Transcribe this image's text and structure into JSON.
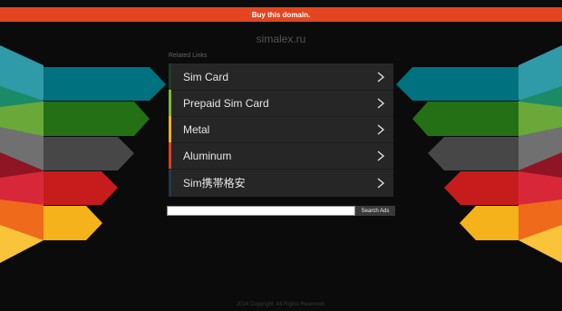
{
  "banner": {
    "label": "Buy this domain.",
    "color": "#e2451f"
  },
  "domain": "simalex.ru",
  "related": {
    "heading": "Related Links",
    "items": [
      {
        "label": "Sim Card",
        "color": "#1f3a2e"
      },
      {
        "label": "Prepaid Sim Card",
        "color": "#7eb936"
      },
      {
        "label": "Metal",
        "color": "#f0b21a"
      },
      {
        "label": "Aluminum",
        "color": "#d9401f"
      },
      {
        "label": "Sim携帯格安",
        "color": "#1f3a4a"
      }
    ]
  },
  "search": {
    "button_label": "Search Ads",
    "placeholder": ""
  },
  "footer": {
    "text": "2024 Copyright. All Rights Reserved."
  },
  "icons": {
    "chevron": "chevron-right-icon"
  }
}
